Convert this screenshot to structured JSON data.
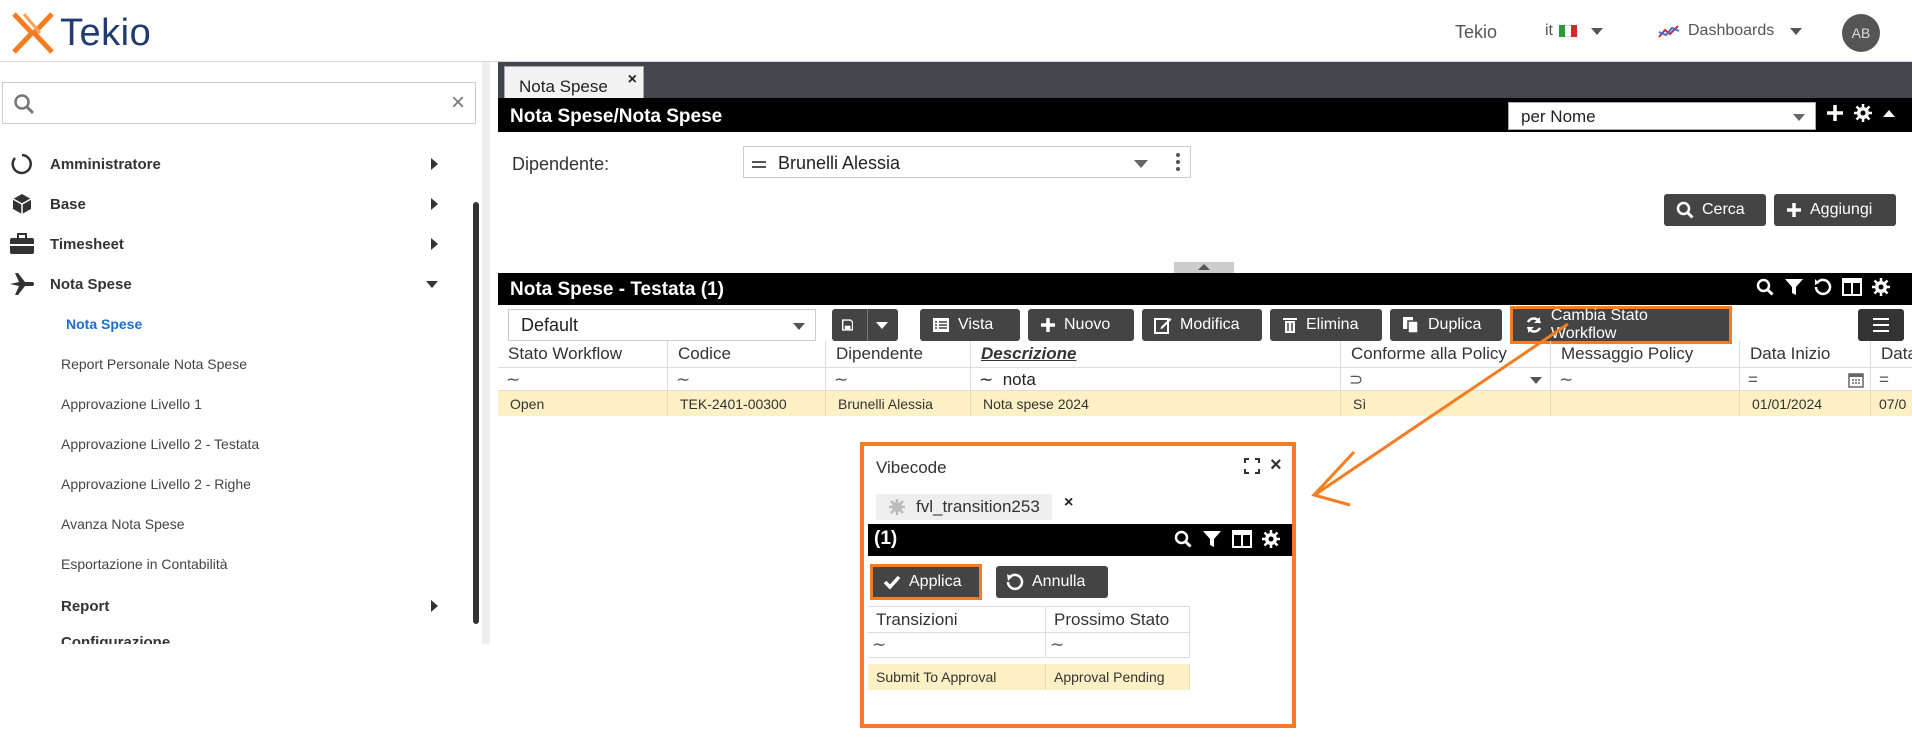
{
  "app": {
    "logo_text": "Tekio",
    "company": "Tekio",
    "language": "it",
    "dashboards_label": "Dashboards",
    "avatar_initials": "AB"
  },
  "sidebar": {
    "search_placeholder": "",
    "items": [
      {
        "label": "Amministratore",
        "icon": "circle-icon"
      },
      {
        "label": "Base",
        "icon": "cube-icon"
      },
      {
        "label": "Timesheet",
        "icon": "briefcase-icon"
      },
      {
        "label": "Nota Spese",
        "icon": "plane-icon"
      }
    ],
    "sub_items": [
      "Nota Spese",
      "Report Personale Nota Spese",
      "Approvazione Livello 1",
      "Approvazione Livello 2 - Testata",
      "Approvazione Livello 2 - Righe",
      "Avanza Nota Spese",
      "Esportazione in Contabilità"
    ],
    "report_label": "Report",
    "config_label": "Configurazione"
  },
  "tabs": [
    "Nota Spese"
  ],
  "search_panel": {
    "title": "Nota Spese/Nota Spese",
    "quick_search": "per Nome",
    "dipendente_label": "Dipendente:",
    "dipendente_value": "Brunelli Alessia",
    "cerca_label": "Cerca",
    "aggiungi_label": "Aggiungi"
  },
  "grid_panel": {
    "title": "Nota Spese - Testata (1)",
    "view_value": "Default",
    "buttons": {
      "vista": "Vista",
      "nuovo": "Nuovo",
      "modifica": "Modifica",
      "elimina": "Elimina",
      "duplica": "Duplica",
      "cambia_stato": "Cambia Stato Workflow"
    },
    "columns": [
      "Stato Workflow",
      "Codice",
      "Dipendente",
      "Descrizione",
      "Conforme alla Policy",
      "Messaggio Policy",
      "Data Inizio",
      "Data"
    ],
    "filter_descrizione": "nota",
    "row": {
      "stato": "Open",
      "codice": "TEK-2401-00300",
      "dipendente": "Brunelli Alessia",
      "descrizione": "Nota spese 2024",
      "conforme": "Sì",
      "messaggio": "",
      "data_inizio": "01/01/2024",
      "data_fine": "07/0"
    }
  },
  "dialog": {
    "title": "Vibecode",
    "tab": "fvl_transition253",
    "bar_title": "(1)",
    "applica_label": "Applica",
    "annulla_label": "Annulla",
    "columns": [
      "Transizioni",
      "Prossimo Stato"
    ],
    "row": {
      "transizione": "Submit To Approval",
      "prossimo_stato": "Approval Pending"
    }
  },
  "colors": {
    "accent_orange": "#f57c20",
    "active_link": "#1e6ed0",
    "row_highlight": "#fdf0c4",
    "dark_button": "#444444",
    "logo_blue": "#1f3b6f"
  }
}
